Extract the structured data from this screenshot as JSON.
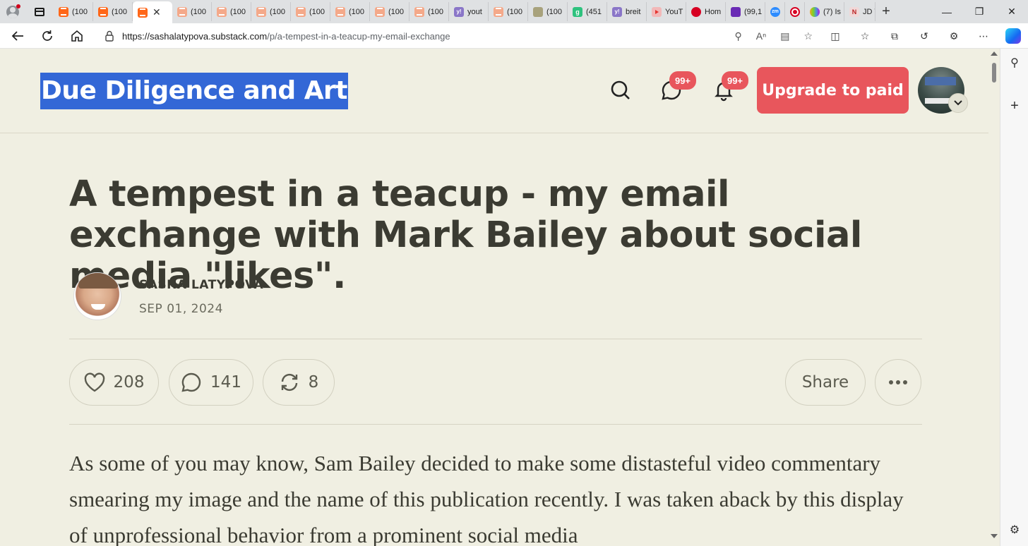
{
  "browser": {
    "tabs": [
      {
        "label": "(100",
        "favicon": "substack-icon"
      },
      {
        "label": "(100",
        "favicon": "substack-icon"
      },
      {
        "label": "",
        "favicon": "substack-icon",
        "active": true
      },
      {
        "label": "(100",
        "favicon": "substack-icon"
      },
      {
        "label": "(100",
        "favicon": "substack-icon"
      },
      {
        "label": "(100",
        "favicon": "substack-icon"
      },
      {
        "label": "(100",
        "favicon": "substack-icon"
      },
      {
        "label": "(100",
        "favicon": "substack-icon"
      },
      {
        "label": "(100",
        "favicon": "substack-icon"
      },
      {
        "label": "(100",
        "favicon": "substack-icon"
      },
      {
        "label": "yout",
        "favicon": "yahoo-icon"
      },
      {
        "label": "(100",
        "favicon": "substack-icon"
      },
      {
        "label": "(100",
        "favicon": "image-icon"
      },
      {
        "label": "(451",
        "favicon": "g-icon"
      },
      {
        "label": "breit",
        "favicon": "yahoo-icon"
      },
      {
        "label": "YouT",
        "favicon": "youtube-icon"
      },
      {
        "label": "Hom",
        "favicon": "red-icon"
      },
      {
        "label": "(99,1",
        "favicon": "mail-icon"
      },
      {
        "label": "",
        "favicon": "zoom-icon"
      },
      {
        "label": "",
        "favicon": "record-icon"
      },
      {
        "label": "(7) Is",
        "favicon": "nbc-icon"
      },
      {
        "label": "JD V",
        "favicon": "n-icon"
      }
    ],
    "url_host": "https://sashalatypova.substack.com",
    "url_path": "/p/a-tempest-in-a-teacup-my-email-exchange"
  },
  "header": {
    "publication": "Due Diligence and Art",
    "messages_badge": "99+",
    "notifications_badge": "99+",
    "upgrade_label": "Upgrade to paid"
  },
  "post": {
    "title": "A tempest in a teacup - my email exchange with Mark Bailey about social media \"likes\".",
    "author": "SASHA LATYPOVA",
    "date": "SEP 01, 2024",
    "likes": "208",
    "comments": "141",
    "restacks": "8",
    "share_label": "Share",
    "body": "As some of you may know, Sam Bailey decided to make some distasteful video commentary smearing my image and the name of this publication recently. I was taken aback by this display of unprofessional behavior from a prominent social media"
  },
  "colors": {
    "accent": "#e8565c",
    "page_bg": "#f0efe2",
    "selection": "#3367d6"
  }
}
